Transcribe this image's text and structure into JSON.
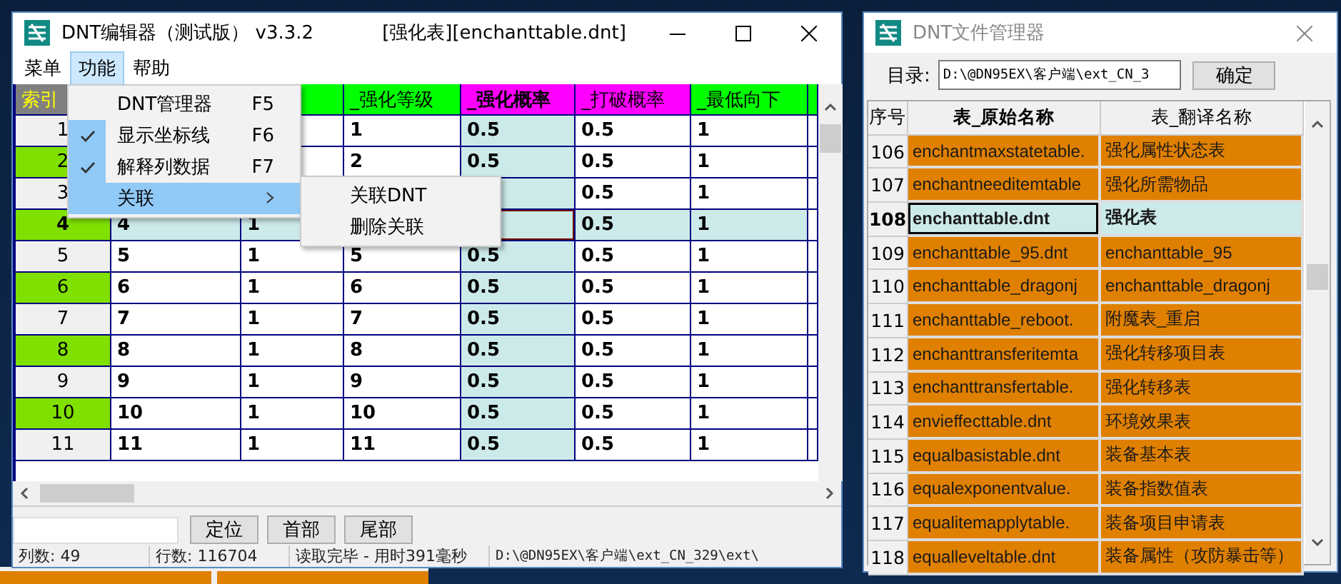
{
  "main_window": {
    "title": "DNT编辑器（测试版） v3.3.2",
    "document": "[强化表][enchanttable.dnt]"
  },
  "menubar": [
    {
      "label": "菜单",
      "selected": false
    },
    {
      "label": "功能",
      "selected": true
    },
    {
      "label": "帮助",
      "selected": false
    }
  ],
  "dropdown": [
    {
      "label": "DNT管理器",
      "shortcut": "F5",
      "checked": false,
      "selected": false,
      "kind": "item"
    },
    {
      "label": "显示坐标线",
      "shortcut": "F6",
      "checked": true,
      "selected": false,
      "kind": "item"
    },
    {
      "label": "解释列数据",
      "shortcut": "F7",
      "checked": true,
      "selected": false,
      "kind": "item"
    },
    {
      "label": "关联",
      "checked": false,
      "selected": true,
      "kind": "submenu"
    }
  ],
  "submenu": [
    {
      "label": "关联DNT"
    },
    {
      "label": "删除关联"
    }
  ],
  "columns": [
    {
      "label": "索引",
      "color": "#808080"
    },
    {},
    {
      "color": "#00ff00"
    },
    {
      "label": "_强化等级",
      "color": "#00ff00"
    },
    {
      "label": "_强化概率",
      "color": "#ff00ff",
      "tinted": true,
      "bold": true
    },
    {
      "label": "_打破概率",
      "color": "#ff00ff"
    },
    {
      "label": "_最低向下",
      "color": "#00ff00"
    },
    {
      "color": "#00ff00"
    }
  ],
  "rows": [
    {
      "index": "1",
      "marked": false,
      "selected": false,
      "cells": [
        null,
        null,
        "1",
        "0.5",
        "0.5",
        "1"
      ]
    },
    {
      "index": "2",
      "marked": true,
      "selected": false,
      "cells": [
        null,
        null,
        "2",
        "0.5",
        "0.5",
        "1"
      ]
    },
    {
      "index": "3",
      "marked": false,
      "selected": false,
      "cells": [
        null,
        null,
        null,
        null,
        "0.5",
        "1"
      ]
    },
    {
      "index": "4",
      "marked": true,
      "selected": true,
      "cells": [
        "4",
        "1",
        null,
        null,
        "0.5",
        "1"
      ]
    },
    {
      "index": "5",
      "marked": false,
      "selected": false,
      "cells": [
        "5",
        "1",
        "5",
        "0.5",
        "0.5",
        "1"
      ]
    },
    {
      "index": "6",
      "marked": true,
      "selected": false,
      "cells": [
        "6",
        "1",
        "6",
        "0.5",
        "0.5",
        "1"
      ]
    },
    {
      "index": "7",
      "marked": false,
      "selected": false,
      "cells": [
        "7",
        "1",
        "7",
        "0.5",
        "0.5",
        "1"
      ]
    },
    {
      "index": "8",
      "marked": true,
      "selected": false,
      "cells": [
        "8",
        "1",
        "8",
        "0.5",
        "0.5",
        "1"
      ]
    },
    {
      "index": "9",
      "marked": false,
      "selected": false,
      "cells": [
        "9",
        "1",
        "9",
        "0.5",
        "0.5",
        "1"
      ]
    },
    {
      "index": "10",
      "marked": true,
      "selected": false,
      "cells": [
        "10",
        "1",
        "10",
        "0.5",
        "0.5",
        "1"
      ]
    },
    {
      "index": "11",
      "marked": false,
      "selected": false,
      "cells": [
        "11",
        "1",
        "11",
        "0.5",
        "0.5",
        "1"
      ]
    }
  ],
  "toolbar": {
    "buttons": [
      "定位",
      "首部",
      "尾部"
    ]
  },
  "status_bar": [
    "列数: 49",
    "行数: 116704",
    "读取完毕 - 用时391毫秒",
    "D:\\@DN95EX\\客户端\\ext_CN_329\\ext\\"
  ],
  "manager": {
    "title": "DNT文件管理器",
    "dir_label": "目录:",
    "dir_value": "D:\\@DN95EX\\客户端\\ext_CN_3",
    "confirm": "确定",
    "columns": [
      "序号",
      "表_原始名称",
      "表_翻译名称"
    ],
    "rows": [
      {
        "no": "106",
        "name": "enchantmaxstatetable.",
        "translation": "强化属性状态表",
        "selected": false
      },
      {
        "no": "107",
        "name": "enchantneeditemtable",
        "translation": "强化所需物品",
        "selected": false
      },
      {
        "no": "108",
        "name": "enchanttable.dnt",
        "translation": "强化表",
        "selected": true
      },
      {
        "no": "109",
        "name": "enchanttable_95.dnt",
        "translation": "enchanttable_95",
        "selected": false
      },
      {
        "no": "110",
        "name": "enchanttable_dragonj",
        "translation": "enchanttable_dragonj",
        "selected": false
      },
      {
        "no": "111",
        "name": "enchanttable_reboot.",
        "translation": "附魔表_重启",
        "selected": false
      },
      {
        "no": "112",
        "name": "enchanttransferitemta",
        "translation": "强化转移项目表",
        "selected": false
      },
      {
        "no": "113",
        "name": "enchanttransfertable.",
        "translation": "强化转移表",
        "selected": false
      },
      {
        "no": "114",
        "name": "envieffecttable.dnt",
        "translation": "环境效果表",
        "selected": false
      },
      {
        "no": "115",
        "name": "equalbasistable.dnt",
        "translation": "装备基本表",
        "selected": false
      },
      {
        "no": "116",
        "name": "equalexponentvalue.",
        "translation": "装备指数值表",
        "selected": false
      },
      {
        "no": "117",
        "name": "equalitemapplytable.",
        "translation": "装备项目申请表",
        "selected": false
      },
      {
        "no": "118",
        "name": "equalleveltable.dnt",
        "translation": "装备属性（攻防暴击等）",
        "selected": false
      }
    ]
  }
}
